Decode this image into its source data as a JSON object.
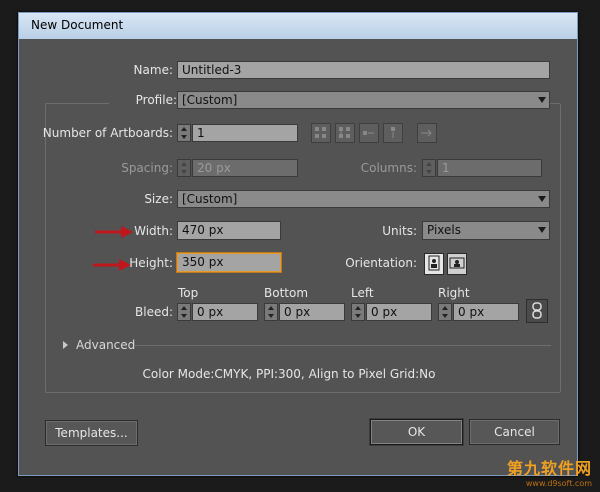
{
  "dialog": {
    "title": "New Document"
  },
  "labels": {
    "name": "Name:",
    "profile": "Profile:",
    "artboards": "Number of Artboards:",
    "spacing": "Spacing:",
    "columns": "Columns:",
    "size": "Size:",
    "width": "Width:",
    "units": "Units:",
    "height": "Height:",
    "orientation": "Orientation:",
    "bleed": "Bleed:",
    "top": "Top",
    "bottom": "Bottom",
    "left": "Left",
    "right": "Right",
    "advanced": "Advanced"
  },
  "values": {
    "name": "Untitled-3",
    "profile": "[Custom]",
    "artboards": "1",
    "spacing": "20 px",
    "columns": "1",
    "size": "[Custom]",
    "width": "470 px",
    "units": "Pixels",
    "height": "350 px",
    "bleed_top": "0 px",
    "bleed_bottom": "0 px",
    "bleed_left": "0 px",
    "bleed_right": "0 px"
  },
  "info": "Color Mode:CMYK, PPI:300, Align to Pixel Grid:No",
  "buttons": {
    "templates": "Templates...",
    "ok": "OK",
    "cancel": "Cancel"
  },
  "watermark": {
    "text": "第九软件网",
    "sub": "www.d9soft.com"
  },
  "colors": {
    "focus": "#e79a2c",
    "annotation_arrow": "#c0161c",
    "titlebar": "#c9dbee"
  }
}
